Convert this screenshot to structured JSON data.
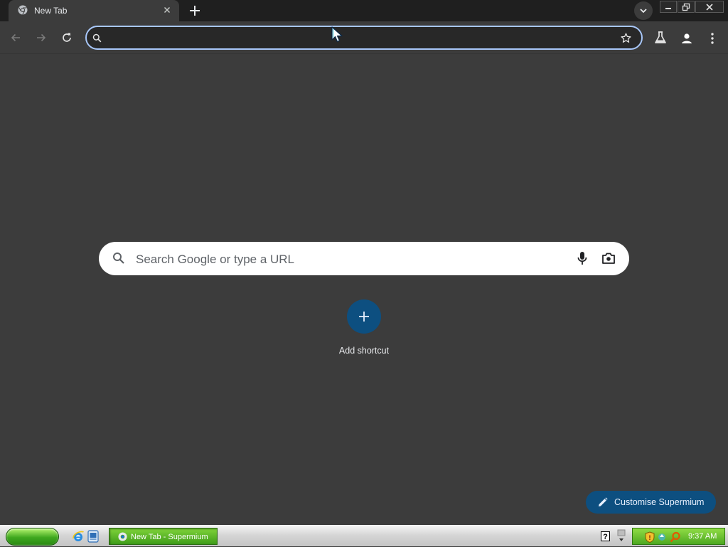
{
  "browser": {
    "tab": {
      "title": "New Tab"
    },
    "omnibox": {
      "value": "",
      "placeholder": ""
    }
  },
  "new_tab_page": {
    "search_placeholder": "Search Google or type a URL",
    "shortcut_label": "Add shortcut",
    "customise_label": "Customise Supermium"
  },
  "taskbar": {
    "task_label": "New Tab - Supermium",
    "clock": "9:37 AM"
  },
  "colors": {
    "page_background": "#3c3c3c",
    "tab_strip": "#1f1f1f",
    "omnibox_focus_ring": "#a8c7fa",
    "accent_button": "#0d4f80",
    "taskbar_green": "#4da821"
  },
  "icons": {
    "tab": [
      "chrome-icon",
      "close-icon",
      "plus-icon",
      "chevron-down-icon"
    ],
    "window": [
      "minimize-icon",
      "restore-icon",
      "close-icon"
    ],
    "toolbar": [
      "back-arrow-icon",
      "forward-arrow-icon",
      "reload-icon",
      "search-icon",
      "star-icon",
      "flask-icon",
      "profile-icon",
      "kebab-menu-icon"
    ],
    "ntp": [
      "search-icon",
      "microphone-icon",
      "camera-icon",
      "plus-icon",
      "pencil-icon"
    ],
    "taskbar": [
      "internet-explorer-icon",
      "desktop-icon",
      "help-icon",
      "chevron-icon",
      "shield-icon",
      "network-icon",
      "search-icon"
    ]
  }
}
